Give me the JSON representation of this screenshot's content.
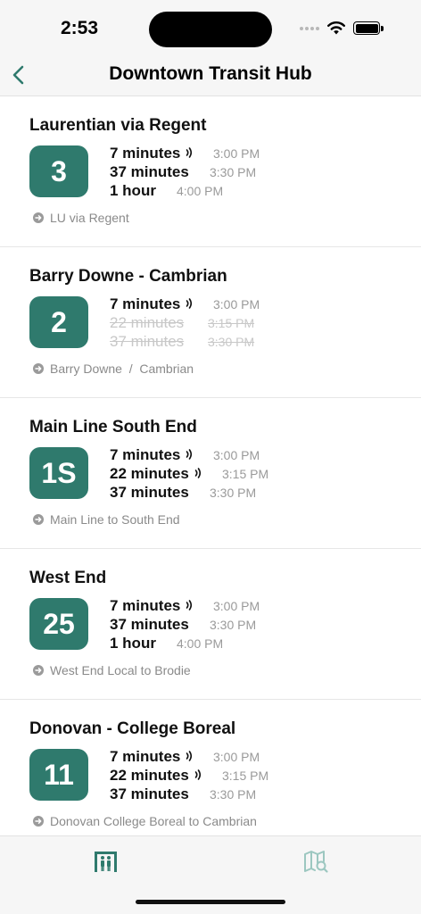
{
  "status": {
    "time": "2:53"
  },
  "nav": {
    "title": "Downtown Transit Hub",
    "back_icon": "chevron-left-icon"
  },
  "colors": {
    "accent": "#2f7a6d",
    "muted": "#9a9a9a",
    "cancelled": "#c8c8c8"
  },
  "routes": [
    {
      "name": "Laurentian via Regent",
      "number": "3",
      "destination": "LU via Regent",
      "departures": [
        {
          "relative": "7 minutes",
          "absolute": "3:00 PM",
          "realtime": true,
          "cancelled": false
        },
        {
          "relative": "37 minutes",
          "absolute": "3:30 PM",
          "realtime": false,
          "cancelled": false
        },
        {
          "relative": "1 hour",
          "absolute": "4:00 PM",
          "realtime": false,
          "cancelled": false
        }
      ]
    },
    {
      "name": "Barry Downe - Cambrian",
      "number": "2",
      "destination": "Barry Downe  /  Cambrian",
      "departures": [
        {
          "relative": "7 minutes",
          "absolute": "3:00 PM",
          "realtime": true,
          "cancelled": false
        },
        {
          "relative": "22 minutes",
          "absolute": "3:15 PM",
          "realtime": false,
          "cancelled": true
        },
        {
          "relative": "37 minutes",
          "absolute": "3:30 PM",
          "realtime": false,
          "cancelled": true
        }
      ]
    },
    {
      "name": "Main Line South End",
      "number": "1S",
      "destination": "Main Line to South End",
      "departures": [
        {
          "relative": "7 minutes",
          "absolute": "3:00 PM",
          "realtime": true,
          "cancelled": false
        },
        {
          "relative": "22 minutes",
          "absolute": "3:15 PM",
          "realtime": true,
          "cancelled": false
        },
        {
          "relative": "37 minutes",
          "absolute": "3:30 PM",
          "realtime": false,
          "cancelled": false
        }
      ]
    },
    {
      "name": "West End",
      "number": "25",
      "destination": "West End Local to Brodie",
      "departures": [
        {
          "relative": "7 minutes",
          "absolute": "3:00 PM",
          "realtime": true,
          "cancelled": false
        },
        {
          "relative": "37 minutes",
          "absolute": "3:30 PM",
          "realtime": false,
          "cancelled": false
        },
        {
          "relative": "1 hour",
          "absolute": "4:00 PM",
          "realtime": false,
          "cancelled": false
        }
      ]
    },
    {
      "name": "Donovan - College Boreal",
      "number": "11",
      "destination": "Donovan College Boreal to Cambrian",
      "departures": [
        {
          "relative": "7 minutes",
          "absolute": "3:00 PM",
          "realtime": true,
          "cancelled": false
        },
        {
          "relative": "22 minutes",
          "absolute": "3:15 PM",
          "realtime": true,
          "cancelled": false
        },
        {
          "relative": "37 minutes",
          "absolute": "3:30 PM",
          "realtime": false,
          "cancelled": false
        }
      ]
    }
  ],
  "tabs": [
    {
      "icon": "bus-stop-icon",
      "selected": true
    },
    {
      "icon": "map-search-icon",
      "selected": false
    }
  ]
}
